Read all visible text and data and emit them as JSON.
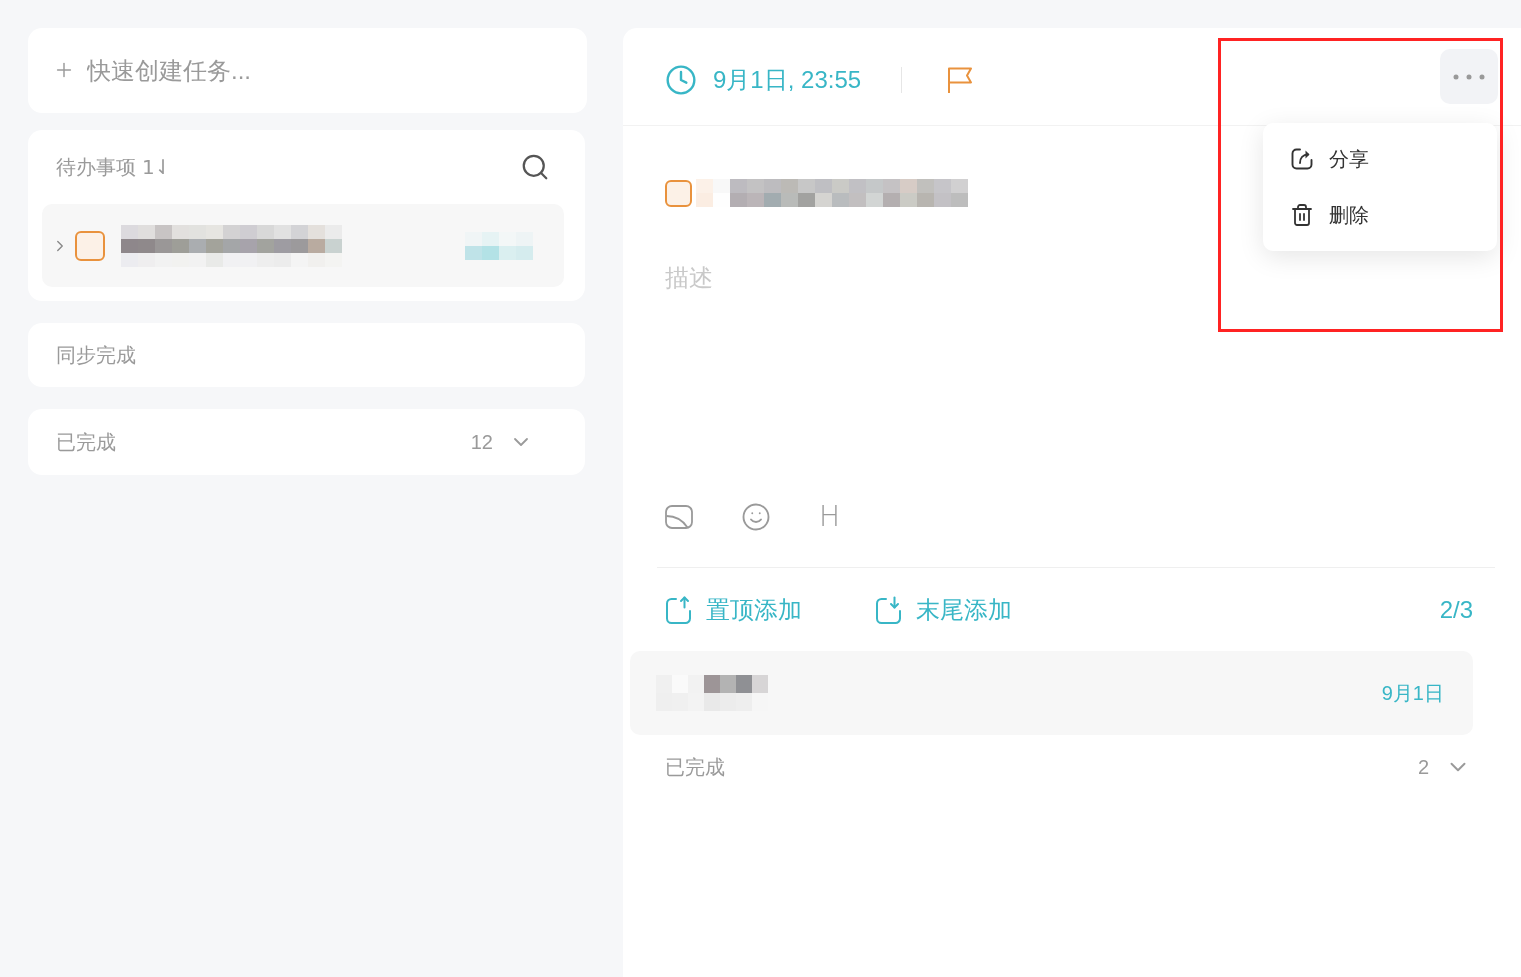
{
  "quick_create": {
    "placeholder": "快速创建任务..."
  },
  "todo": {
    "title": "待办事项",
    "sort": "1⇃",
    "tasks": [
      {
        "expanded": false,
        "checked": false
      }
    ]
  },
  "sections": [
    {
      "kind": "plain",
      "title": "同步完成"
    },
    {
      "kind": "collapsible",
      "title": "已完成",
      "count": "12",
      "expanded": false
    }
  ],
  "detail": {
    "due": "9月1日, 23:55",
    "checked": false,
    "menu": {
      "open": true,
      "items": [
        {
          "kind": "share",
          "label": "分享"
        },
        {
          "kind": "delete",
          "label": "删除"
        }
      ]
    },
    "description": {
      "placeholder": "描述"
    },
    "tools": [
      {
        "kind": "image"
      },
      {
        "kind": "emoji"
      },
      {
        "kind": "heading",
        "label": "H"
      }
    ],
    "subtasks": {
      "actions": [
        {
          "kind": "top",
          "label": "置顶添加"
        },
        {
          "kind": "bottom",
          "label": "末尾添加"
        }
      ],
      "progress": "2/3",
      "items": [
        {
          "due": "9月1日"
        }
      ],
      "completed": {
        "label": "已完成",
        "count": "2",
        "expanded": false
      }
    }
  }
}
